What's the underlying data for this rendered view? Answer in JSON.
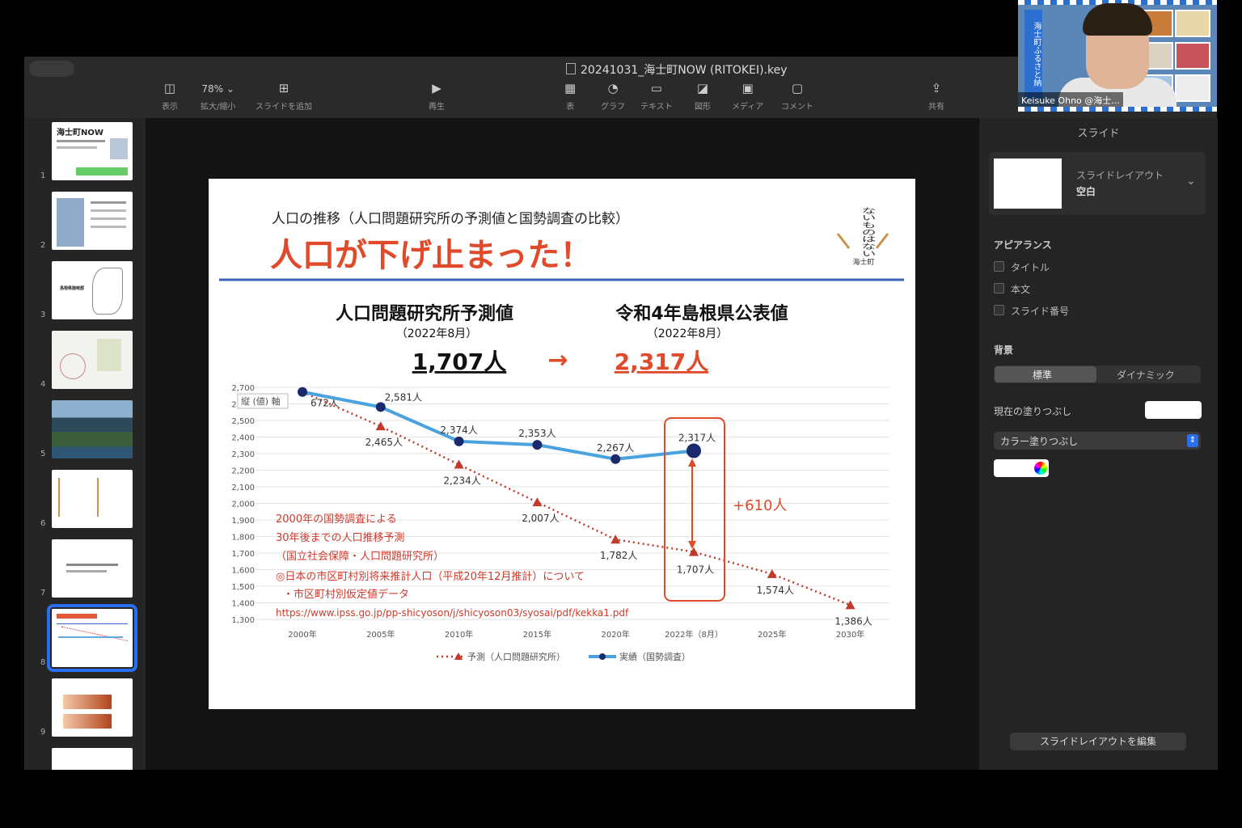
{
  "window": {
    "title": "20241031_海士町NOW (RITOKEI).key"
  },
  "toolbar": {
    "view": "表示",
    "zoom_value": "78%",
    "zoom_label": "拡大/縮小",
    "add_slide": "スライドを追加",
    "play": "再生",
    "table": "表",
    "chart": "グラフ",
    "text": "テキスト",
    "shape": "図形",
    "media": "メディア",
    "comment": "コメント",
    "share": "共有"
  },
  "thumbnails": {
    "numbers": [
      "1",
      "2",
      "3",
      "4",
      "5",
      "6",
      "7",
      "8",
      "9"
    ],
    "t1_title": "海士町NOW",
    "t3_label": "島根県隠岐郡",
    "selected": 8
  },
  "slide": {
    "subtitle": "人口の推移（人口問題研究所の予測値と国勢調査の比較）",
    "headline": "人口が下げ止まった！",
    "logo_text": "ないものはない",
    "logo_sub": "海士町",
    "left_head": "人口問題研究所予測値",
    "left_date": "（2022年8月）",
    "left_value": "1,707人",
    "arrow": "→",
    "right_head": "令和4年島根県公表値",
    "right_date": "（2022年8月）",
    "right_value": "2,317人",
    "axis_tag": "縦 (値) 軸",
    "diff": "+610人",
    "note_lines": [
      "2000年の国勢調査による",
      "30年後までの人口推移予測",
      "（国立社会保障・人口問題研究所）",
      "◎日本の市区町村別将来推計人口（平成20年12月推計）について",
      "・市区町村別仮定値データ"
    ],
    "note_url": "https://www.ipss.go.jp/pp-shicyoson/j/shicyoson03/syosai/pdf/kekka1.pdf"
  },
  "chart_data": {
    "type": "line",
    "x": [
      "2000年",
      "2005年",
      "2010年",
      "2015年",
      "2020年",
      "2022年（8月）",
      "2025年",
      "2030年"
    ],
    "ylim": [
      1300,
      2700
    ],
    "yticks": [
      "1,300",
      "1,400",
      "1,500",
      "1,600",
      "1,700",
      "1,800",
      "1,900",
      "2,000",
      "2,100",
      "2,200",
      "2,300",
      "2,400",
      "2,500",
      "2,600",
      "2,700"
    ],
    "grid": true,
    "legend_position": "bottom",
    "series": [
      {
        "name": "予測（人口問題研究所）",
        "color": "#c0392b",
        "style": "dotted",
        "values": [
          2672,
          2465,
          2234,
          2007,
          1782,
          1707,
          1574,
          1386
        ],
        "labels": [
          "672人",
          "2,465人",
          "2,234人",
          "2,007人",
          "1,782人",
          "1,707人",
          "1,574人",
          "1,386人"
        ]
      },
      {
        "name": "実績（国勢調査）",
        "color": "#4aa3df",
        "point_color": "#1a2a6c",
        "style": "solid",
        "values": [
          2672,
          2581,
          2374,
          2353,
          2267,
          2317
        ],
        "labels": [
          "",
          "2,581人",
          "2,374人",
          "2,353人",
          "2,267人",
          "2,317人"
        ]
      }
    ]
  },
  "inspector": {
    "tab": "スライド",
    "layout_label": "スライドレイアウト",
    "layout_value": "空白",
    "appearance": "アピアランス",
    "title_opt": "タイトル",
    "body_opt": "本文",
    "number_opt": "スライド番号",
    "background": "背景",
    "seg_standard": "標準",
    "seg_dynamic": "ダイナミック",
    "fill_label": "現在の塗りつぶし",
    "fill_type": "カラー塗りつぶし",
    "edit_layout": "スライドレイアウトを編集"
  },
  "webcam": {
    "name": "Keisuke Ohno @海士...",
    "banner": "海士町ふるさと納"
  }
}
